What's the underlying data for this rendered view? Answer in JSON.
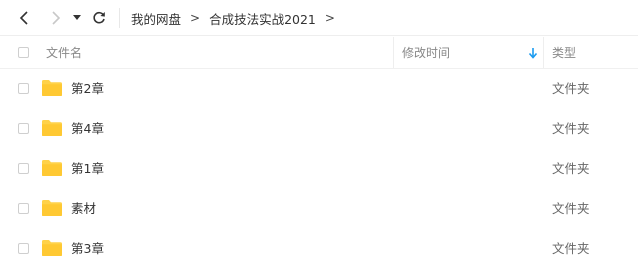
{
  "nav": {
    "back_icon": "chevron-left-icon",
    "forward_icon": "chevron-right-icon",
    "dropdown_icon": "caret-down-icon",
    "refresh_icon": "refresh-icon"
  },
  "breadcrumb": [
    "我的网盘",
    "合成技法实战2021"
  ],
  "breadcrumb_separator": ">",
  "columns": {
    "name": "文件名",
    "modified": "修改时间",
    "type": "类型"
  },
  "sort_indicator": "arrow-down-icon",
  "colors": {
    "folder": "#FFD24A",
    "sort_arrow": "#1A9BF0"
  },
  "rows": [
    {
      "name": "第2章",
      "modified": "",
      "type": "文件夹",
      "icon": "folder-icon"
    },
    {
      "name": "第4章",
      "modified": "",
      "type": "文件夹",
      "icon": "folder-icon"
    },
    {
      "name": "第1章",
      "modified": "",
      "type": "文件夹",
      "icon": "folder-icon"
    },
    {
      "name": "素材",
      "modified": "",
      "type": "文件夹",
      "icon": "folder-icon"
    },
    {
      "name": "第3章",
      "modified": "",
      "type": "文件夹",
      "icon": "folder-icon"
    }
  ]
}
